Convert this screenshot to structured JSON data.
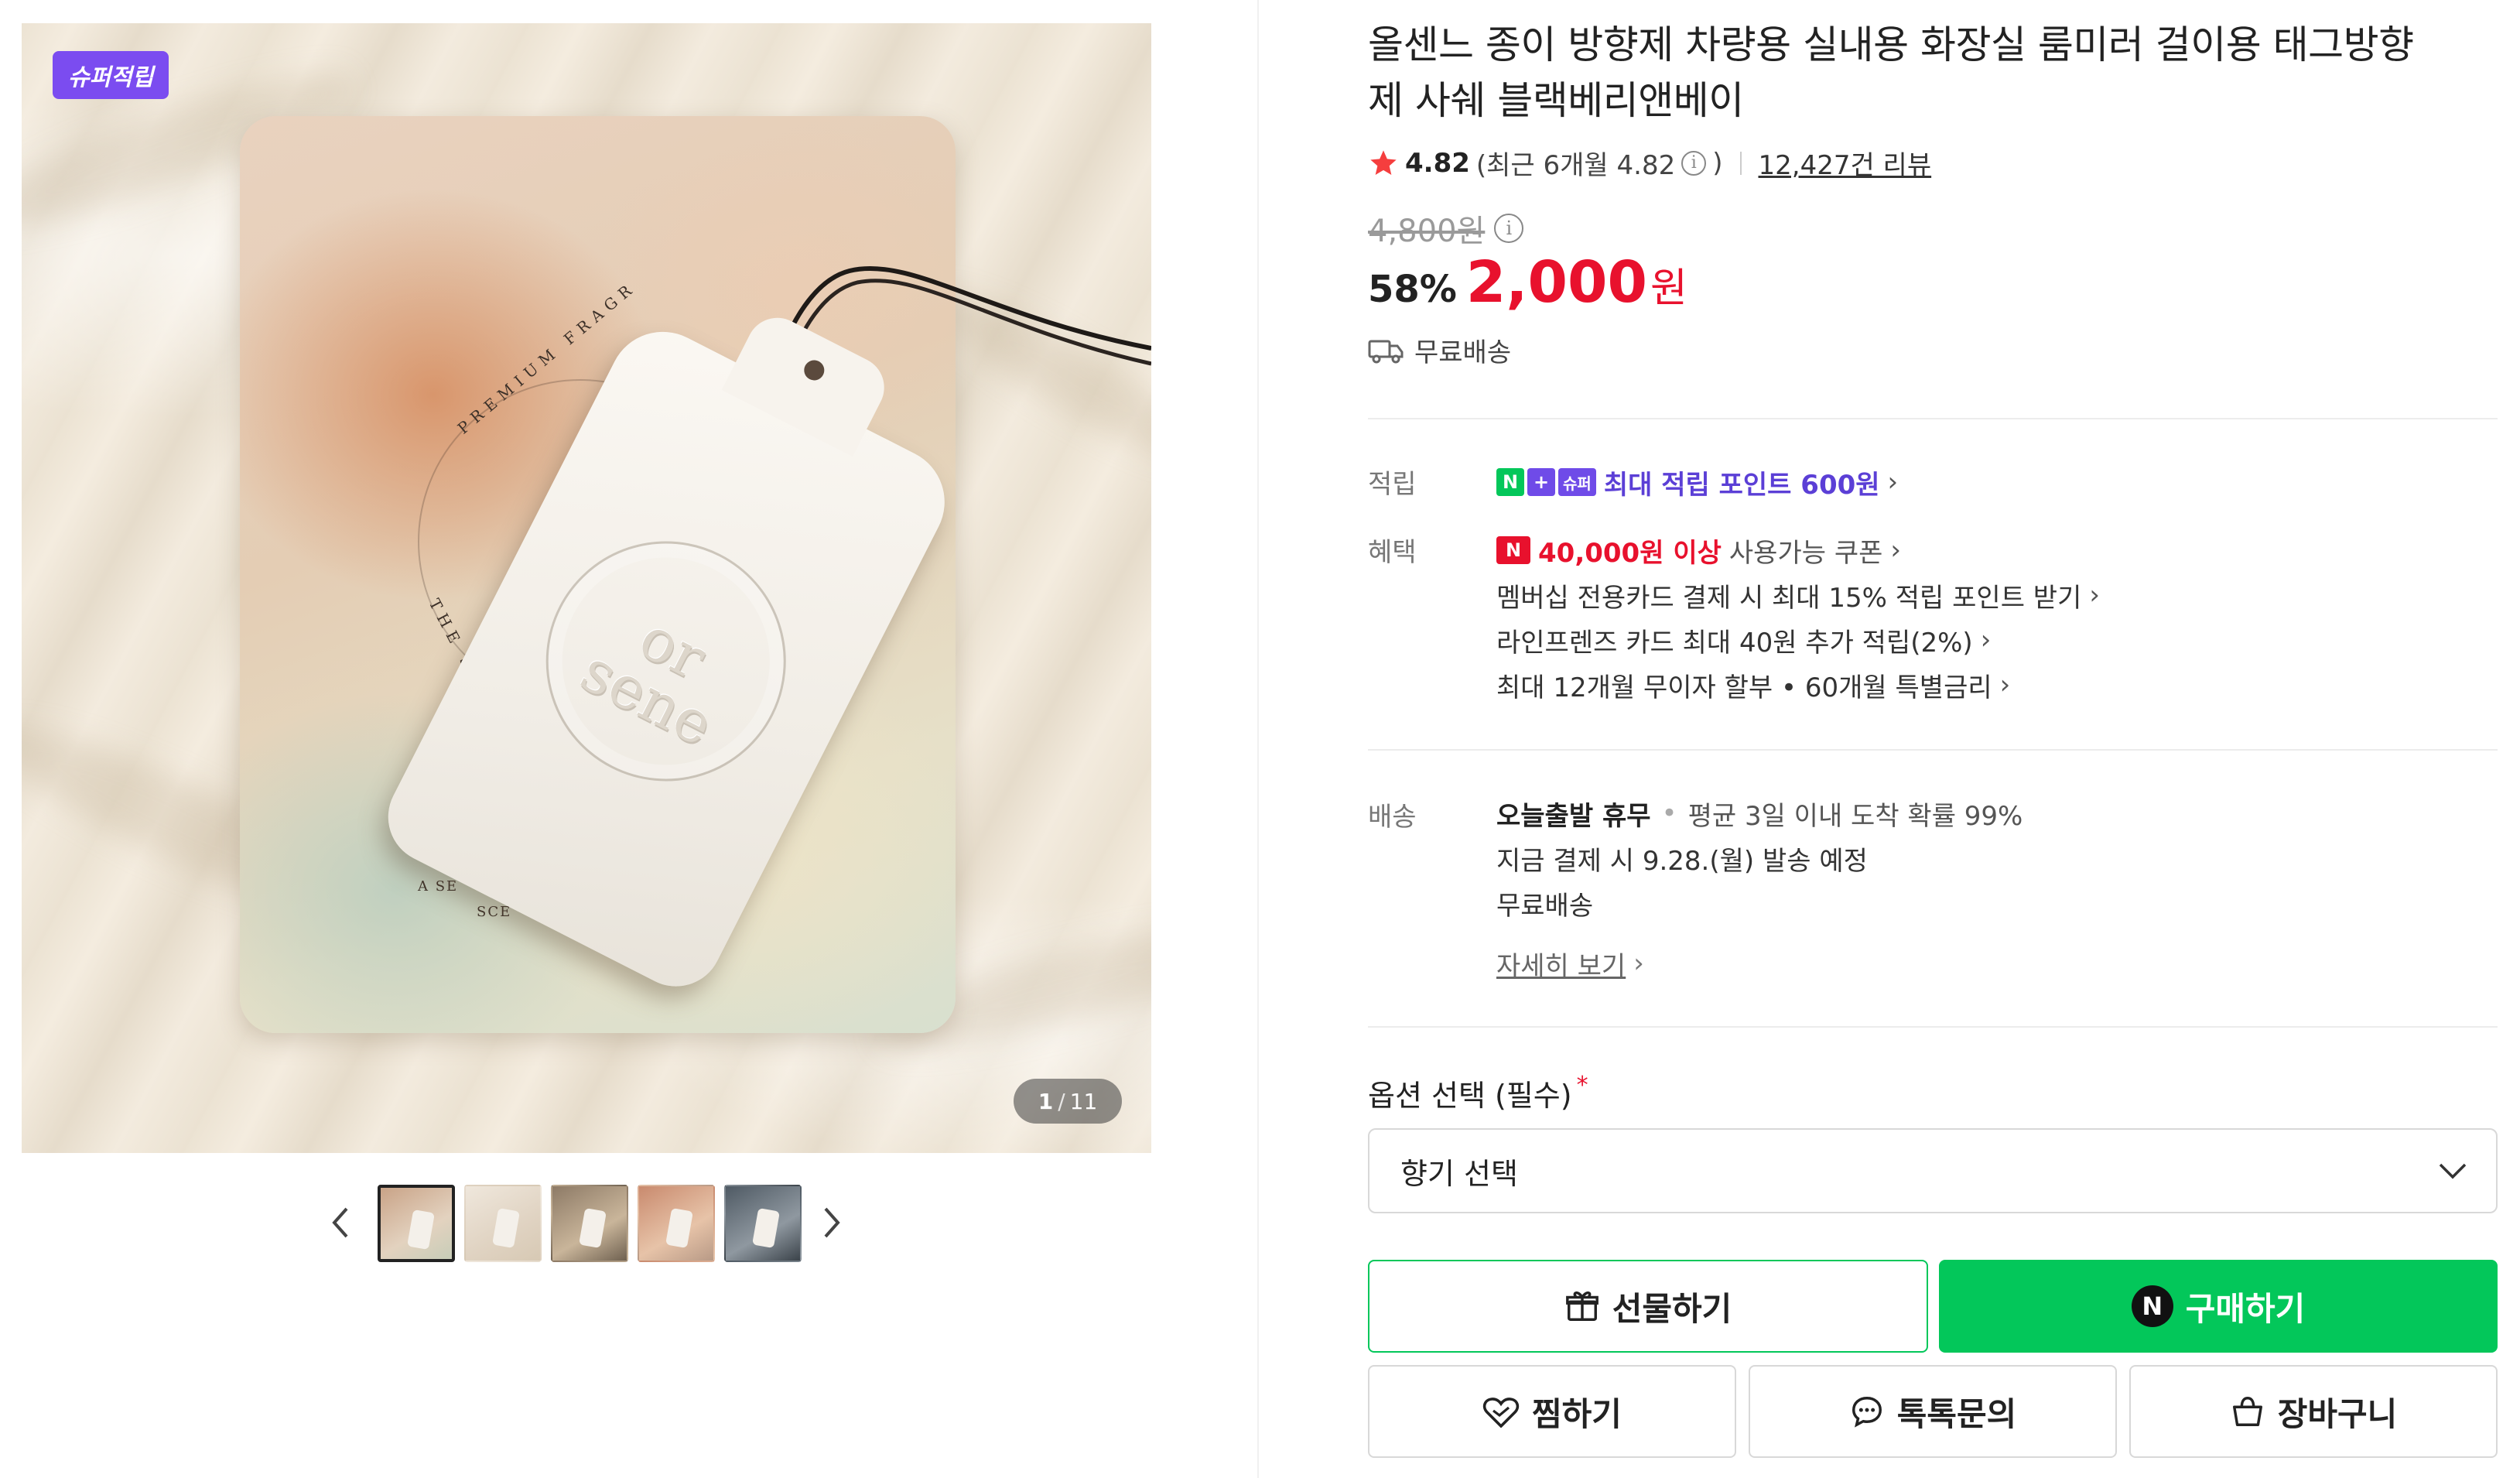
{
  "gallery": {
    "badge": "슈퍼적립",
    "counter_current": "1",
    "counter_sep": "/",
    "counter_total": "11",
    "pouch_text_top": "PREMIUM FRAGR",
    "pouch_text_left": "THE SCE",
    "pouch_text_bottom1": "A SE",
    "pouch_text_bottom2": "SCE",
    "tag_logo_line1": "or",
    "tag_logo_line2": "sene"
  },
  "product": {
    "title": "올센느 종이 방향제 차량용 실내용 화장실 룸미러 걸이용 태그방향제 사쉐 블랙베리앤베이",
    "rating": "4.82",
    "recent_rating": "(최근 6개월 4.82",
    "recent_rating_close": ")",
    "review_count": "12,427건 리뷰",
    "original_price": "4,800원",
    "discount": "58%",
    "sale_price": "2,000",
    "currency": "원",
    "shipping_short": "무료배송"
  },
  "benefits": {
    "accrual_label": "적립",
    "accrual_badge_n": "N",
    "accrual_badge_plus": "+",
    "accrual_badge_super": "슈퍼",
    "accrual_text": "최대 적립 포인트 600원",
    "benefit_label": "혜택",
    "coupon_badge": "N",
    "coupon_amount": "40,000원 이상",
    "coupon_text": "사용가능 쿠폰",
    "membership": "멤버십 전용카드 결제 시 최대 15% 적립 포인트 받기",
    "card": "라인프렌즈 카드 최대 40원 추가 적립(2%)",
    "installment": "최대 12개월 무이자 할부 • 60개월 특별금리"
  },
  "delivery": {
    "label": "배송",
    "today": "오늘출발 휴무",
    "avg": "평균 3일 이내 도착 확률 99%",
    "schedule": "지금 결제 시 9.28.(월) 발송 예정",
    "fee": "무료배송",
    "details": "자세히 보기"
  },
  "options": {
    "label": "옵션 선택 (필수)",
    "required_mark": "*",
    "select_placeholder": "향기 선택"
  },
  "actions": {
    "gift": "선물하기",
    "buy": "구매하기",
    "buy_logo": "N",
    "wish": "찜하기",
    "talk": "톡톡문의",
    "cart": "장바구니"
  },
  "colors": {
    "accent_green": "#03c75a",
    "price_red": "#e8112d",
    "super_purple": "#7b4cf0"
  }
}
